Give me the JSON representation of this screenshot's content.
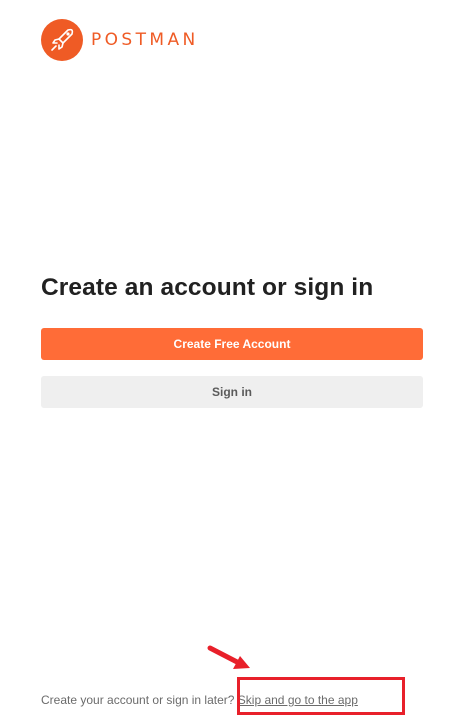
{
  "brand": {
    "wordmark": "POSTMAN",
    "accent_color": "#ff6c37",
    "logo_icon": "postman-rocket-icon"
  },
  "main": {
    "title": "Create an account or sign in",
    "primary_button": "Create Free Account",
    "secondary_button": "Sign in"
  },
  "footer": {
    "prompt": "Create your account or sign in later?",
    "skip_link": "Skip and go to the app"
  },
  "annotation": {
    "color": "#e8202a",
    "arrow_icon": "red-arrow-icon"
  }
}
